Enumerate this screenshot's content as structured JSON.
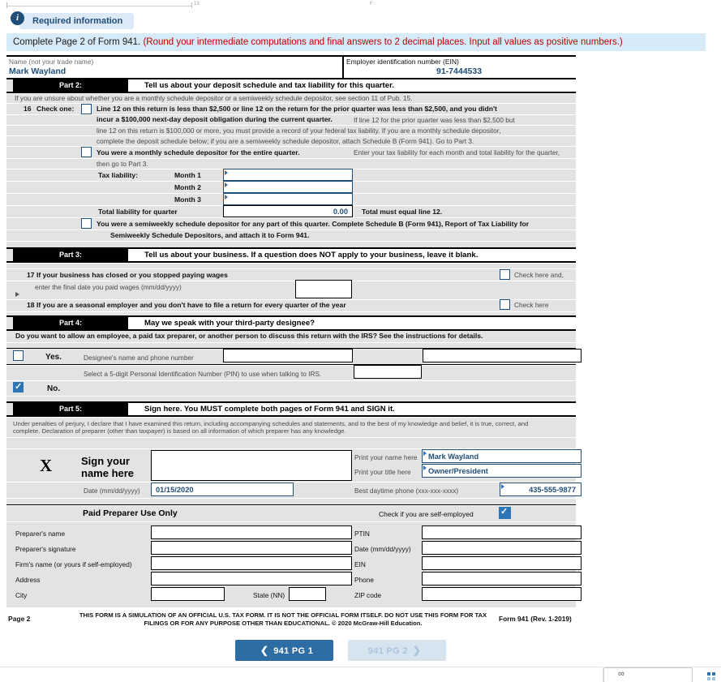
{
  "required_badge": {
    "icon": "info-icon",
    "icon_glyph": "i",
    "label": "Required information"
  },
  "instruction_banner": {
    "black_text": "Complete Page 2 of Form 941.",
    "red_text": "(Round your intermediate computations and final answers to 2 decimal places. Input all values as positive numbers.)"
  },
  "identity": {
    "name_label": "Name (not your trade name)",
    "name_value": "Mark Wayland",
    "ein_label": "Employer identification number (EIN)",
    "ein_value": "91-7444533"
  },
  "part2": {
    "bar_label": "Part 2:",
    "title": "Tell us about your deposit schedule and tax liability for this quarter.",
    "note": "If you are unsure about whether you are a monthly schedule depositor or a semiweekly schedule depositor, see section 11 of Pub. 15.",
    "line16_number": "16",
    "line16_label": "Check one:",
    "option1_line1": "Line 12 on this return is less than $2,500 or line 12 on the return for the prior quarter was less than $2,500, and you didn't",
    "option1_line2": "incur a $100,000 next-day deposit obligation during the current quarter.",
    "option1_side1": "If line 12 for the prior quarter was less than $2,500 but",
    "option1_side2": "line 12 on this return is $100,000 or more, you must provide a  record of your federal tax liability.  If  you are a  monthly schedule depositor,",
    "option1_side3": "complete the deposit schedule below; if you are a semiweekly schedule depositor, attach Schedule B (Form 941). Go to Part 3.",
    "option1_checked": false,
    "option2_text": "You were a monthly schedule depositor for the entire quarter.",
    "option2_side": "Enter your tax liability for each month and total liability for the quarter,",
    "option2_side2": "then go to Part 3.",
    "option2_checked": false,
    "tax_liability_label": "Tax liability:",
    "months": [
      {
        "label": "Month 1",
        "value": ""
      },
      {
        "label": "Month 2",
        "value": ""
      },
      {
        "label": "Month 3",
        "value": ""
      }
    ],
    "total_label": "Total liability for quarter",
    "total_value": "0.00",
    "total_note": "Total must equal line 12.",
    "option3_line1": "You were a semiweekly schedule depositor for any part of this quarter.  Complete Schedule B (Form 941), Report of Tax Liability for",
    "option3_line2": "Semiweekly Schedule Depositors, and attach it to Form 941.",
    "option3_checked": false
  },
  "part3": {
    "bar_label": "Part 3:",
    "title": "Tell us about your business.  If a question does NOT apply to your business, leave it blank.",
    "line17_text": "17 If your business has closed or you stopped paying wages",
    "line17_sub": "enter the final date you paid wages (mm/dd/yyyy)",
    "line17_check_label": "Check here and,",
    "line17_checked": false,
    "line17_date_value": "",
    "line18_text": "18 If you are a seasonal employer and you don't have to file a return for every quarter of the year",
    "line18_check_label": "Check here",
    "line18_checked": false
  },
  "part4": {
    "bar_label": "Part 4:",
    "title": "May we speak with your third-party designee?",
    "question": "Do you want to allow an employee, a paid tax preparer, or another person to discuss this return with the IRS?  See the instructions for details.",
    "yes_label": "Yes.",
    "yes_checked": false,
    "no_label": "No.",
    "no_checked": true,
    "designee_label": "Designee's name and phone number",
    "designee_name_value": "",
    "designee_phone_value": "",
    "pin_label": "Select a 5-digit Personal Identification Number (PIN) to use when talking to IRS.",
    "pin_value": ""
  },
  "part5": {
    "bar_label": "Part 5:",
    "title": "Sign here.  You MUST complete both pages of Form 941 and SIGN it.",
    "perjury_line1": "Under penalties of perjury, I declare that I have examined this return, including accompanying schedules and statements, and to the best of my knowledge and belief, it is true, correct, and",
    "perjury_line2": "complete. Declaration of preparer (other than taxpayer) is based on all information of which preparer has any knowledge.",
    "x_mark": "X",
    "sign_line1": "Sign your",
    "sign_line2": "name here",
    "signature_value": "",
    "print_name_label": "Print your name here",
    "print_name_value": "Mark Wayland",
    "print_title_label": "Print your title here",
    "print_title_value": "Owner/President",
    "date_label": "Date (mm/dd/yyyy)",
    "date_value": "01/15/2020",
    "phone_label": "Best daytime phone (xxx-xxx-xxxx)",
    "phone_value": "435-555-9877"
  },
  "preparer": {
    "heading": "Paid Preparer Use Only",
    "self_employed_label": "Check if you are self-employed",
    "self_employed_checked": true,
    "rows": [
      {
        "left_label": "Preparer's name",
        "left_value": "",
        "right_label": "PTIN",
        "right_value": ""
      },
      {
        "left_label": "Preparer's signature",
        "left_value": "",
        "right_label": "Date (mm/dd/yyyy)",
        "right_value": ""
      },
      {
        "left_label": "Firm's name (or yours if self-employed)",
        "left_value": "",
        "right_label": "EIN",
        "right_value": ""
      },
      {
        "left_label": "Address",
        "left_value": "",
        "right_label": "Phone",
        "right_value": ""
      }
    ],
    "city_label": "City",
    "city_value": "",
    "state_label": "State (NN)",
    "state_value": "",
    "zip_label": "ZIP code",
    "zip_value": ""
  },
  "footer": {
    "page_label": "Page 2",
    "disclaimer_line1": "THIS FORM IS A SIMULATION OF AN OFFICIAL U.S. TAX FORM. IT IS NOT THE OFFICIAL FORM ITSELF. DO NOT USE THIS FORM",
    "disclaimer_line2": "FOR TAX FILINGS OR FOR ANY PURPOSE OTHER THAN EDUCATIONAL. © 2020 McGraw-Hill Education.",
    "form_ref": "Form 941 (Rev. 1-2019)"
  },
  "nav": {
    "prev_label": "941 PG 1",
    "prev_icon": "chevron-left-icon",
    "next_label": "941 PG 2",
    "next_icon": "chevron-right-icon"
  },
  "colors": {
    "accent_blue": "#1f4e79",
    "checkbox_blue": "#2e75b6",
    "banner_bg": "#d6eaf8",
    "grid_grey": "#e3e3e3",
    "red": "#c00000",
    "btn_active": "#2e6da4",
    "btn_disabled": "#d6e4f0"
  }
}
